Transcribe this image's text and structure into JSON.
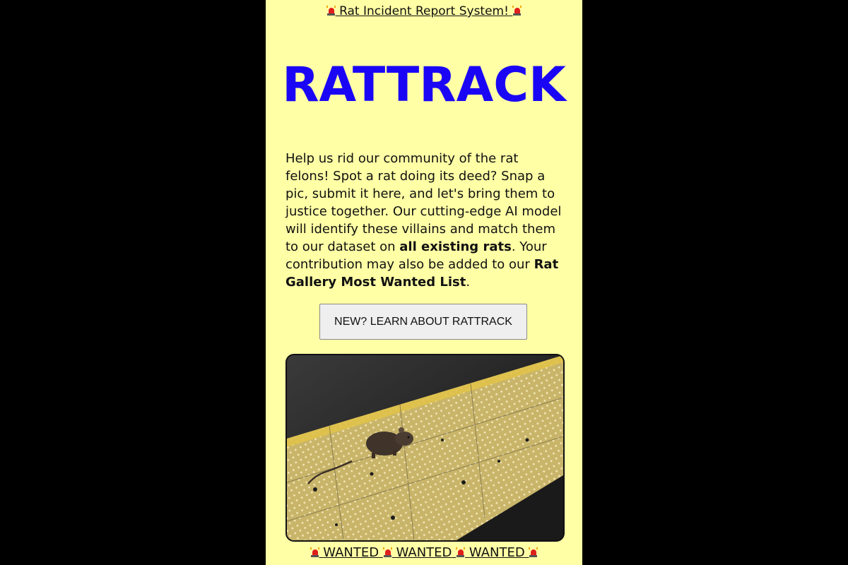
{
  "banner": {
    "text": "Rat Incident Report System!",
    "icon": "police-light-icon"
  },
  "hero": {
    "title": "RATTRACK"
  },
  "intro": {
    "part1": "Help us rid our community of the rat felons! Spot a rat doing its deed? Snap a pic, submit it here, and let's bring them to justice together. Our cutting-edge AI model will identify these villains and match them to our dataset on ",
    "bold1": "all existing rats",
    "part2": ". Your contribution may also be added to our ",
    "bold2": "Rat Gallery Most Wanted List",
    "part3": "."
  },
  "learn_button": {
    "label": "NEW? LEARN ABOUT RATTRACK"
  },
  "photo": {
    "subject": "rat-on-subway-platform-photo"
  },
  "wanted_banner": {
    "words": [
      "WANTED",
      "WANTED",
      "WANTED"
    ],
    "icon": "police-light-icon"
  },
  "colors": {
    "page_background": "#ffffa6",
    "outer_background": "#000000",
    "title_blue": "#1a06f5",
    "siren_red": "#e0201b"
  }
}
